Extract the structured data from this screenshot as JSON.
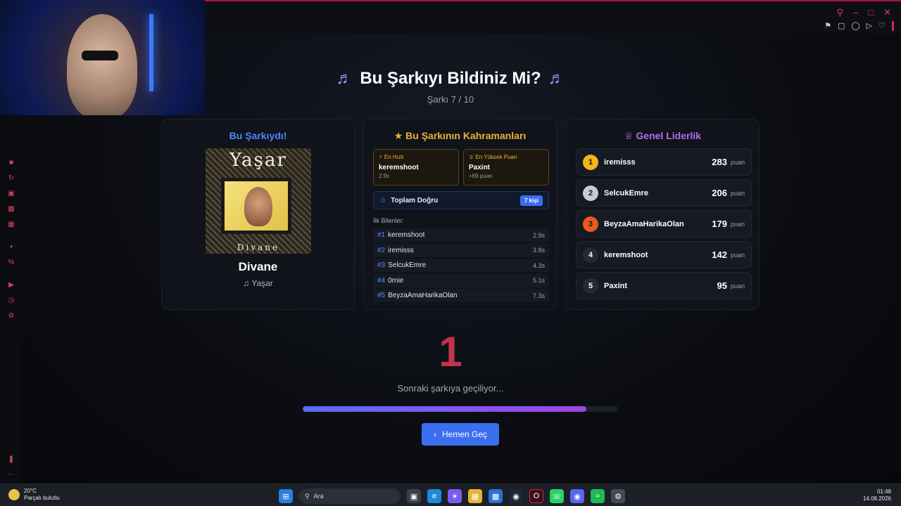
{
  "window": {
    "controls": [
      "search-icon",
      "minimize-icon",
      "maximize-icon",
      "close-icon"
    ]
  },
  "header": {
    "title": "Bu Şarkıyı Bildiniz Mi?",
    "subtitle": "Şarkı 7 / 10"
  },
  "song_card": {
    "title": "Bu Şarkıydı!",
    "album_art_title": "Yaşar",
    "album_art_subtitle": "Divane",
    "song": "Divane",
    "artist": "Yaşar"
  },
  "heroes_card": {
    "title": "Bu Şarkının Kahramanları",
    "fastest": {
      "label": "En Hızlı",
      "name": "keremshoot",
      "value": "2.9s"
    },
    "top_score": {
      "label": "En Yüksek Puan",
      "name": "Paxint",
      "value": "+69 puan"
    },
    "total": {
      "label": "Toplam Doğru",
      "badge": "7 kişi"
    },
    "first_label": "İlk Bilenler:",
    "first": [
      {
        "rank": "#1",
        "name": "keremshoot",
        "time": "2.9s"
      },
      {
        "rank": "#2",
        "name": "iremisss",
        "time": "3.8s"
      },
      {
        "rank": "#3",
        "name": "SelcukEmre",
        "time": "4.3s"
      },
      {
        "rank": "#4",
        "name": "0rnie",
        "time": "5.1s"
      },
      {
        "rank": "#5",
        "name": "BeyzaAmaHarikaOlan",
        "time": "7.3s"
      }
    ]
  },
  "leader_card": {
    "title": "Genel Liderlik",
    "unit": "puan",
    "rows": [
      {
        "rank": "1",
        "name": "iremisss",
        "score": "283",
        "color": "#f2b61d"
      },
      {
        "rank": "2",
        "name": "SelcukEmre",
        "score": "206",
        "color": "#c9ccd2"
      },
      {
        "rank": "3",
        "name": "BeyzaAmaHarikaOlan",
        "score": "179",
        "color": "#ea5a1c"
      },
      {
        "rank": "4",
        "name": "keremshoot",
        "score": "142",
        "color": "#262a33"
      },
      {
        "rank": "5",
        "name": "Paxint",
        "score": "95",
        "color": "#262a33"
      }
    ]
  },
  "countdown": {
    "value": "1",
    "text": "Sonraki şarkıya geçiliyor...",
    "progress": 0.9
  },
  "skip_button": {
    "label": "Hemen Geç"
  },
  "taskbar": {
    "weather_temp": "20°C",
    "weather_desc": "Parçalı bulutlu",
    "search_placeholder": "Ara",
    "time": "01:48",
    "date": "14.08.2026"
  },
  "colors": {
    "accent_blue": "#3b6ff0",
    "accent_purple": "#a045e6",
    "countdown_red": "#c2334d",
    "gold": "#e8b437"
  }
}
